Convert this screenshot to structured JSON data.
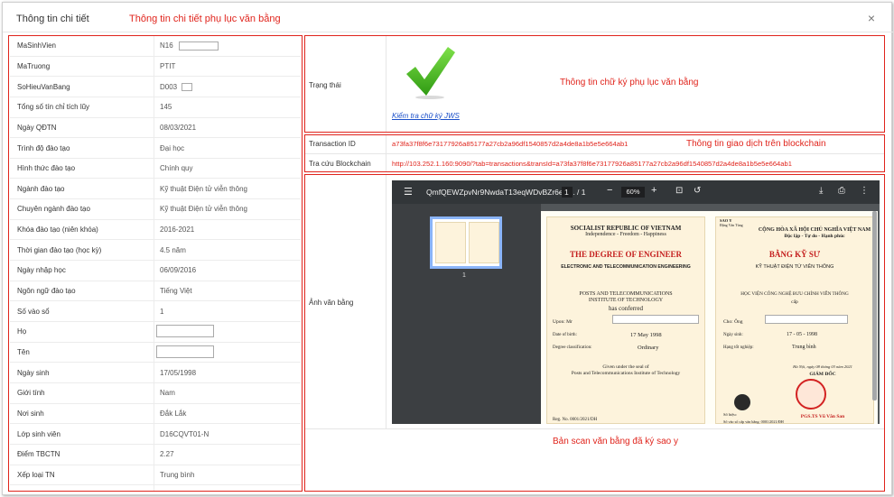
{
  "header": {
    "title": "Thông tin chi tiết",
    "annotation": "Thông tin chi tiết phụ lục văn bằng",
    "close_icon": "×"
  },
  "details": [
    {
      "label": "MaSinhVien",
      "value": "N16"
    },
    {
      "label": "MaTruong",
      "value": "PTIT"
    },
    {
      "label": "SoHieuVanBang",
      "value": "D003"
    },
    {
      "label": "Tổng số tín chỉ tích lũy",
      "value": "145"
    },
    {
      "label": "Ngày QĐTN",
      "value": "08/03/2021"
    },
    {
      "label": "Trình độ đào tạo",
      "value": "Đại học"
    },
    {
      "label": "Hình thức đào tạo",
      "value": "Chính quy"
    },
    {
      "label": "Ngành đào tạo",
      "value": "Kỹ thuật Điện tử viễn thông"
    },
    {
      "label": "Chuyên ngành đào tạo",
      "value": "Kỹ thuật Điện tử viễn thông"
    },
    {
      "label": "Khóa đào tạo (niên khóa)",
      "value": "2016-2021"
    },
    {
      "label": "Thời gian đào tạo (học kỳ)",
      "value": "4.5 năm"
    },
    {
      "label": "Ngày nhập học",
      "value": "06/09/2016"
    },
    {
      "label": "Ngôn ngữ đào tạo",
      "value": "Tiếng Việt"
    },
    {
      "label": "Số vào sổ",
      "value": "1"
    },
    {
      "label": "Họ",
      "value": ""
    },
    {
      "label": "Tên",
      "value": ""
    },
    {
      "label": "Ngày sinh",
      "value": "17/05/1998"
    },
    {
      "label": "Giới tính",
      "value": "Nam"
    },
    {
      "label": "Nơi sinh",
      "value": "Đắk Lắk"
    },
    {
      "label": "Lớp sinh viên",
      "value": "D16CQVT01-N"
    },
    {
      "label": "Điểm TBCTN",
      "value": "2.27"
    },
    {
      "label": "Xếp loại TN",
      "value": "Trung bình"
    }
  ],
  "signature": {
    "label": "Trạng thái",
    "annotation": "Thông tin chữ ký phụ lục văn bằng",
    "link": "Kiểm tra chữ ký JWS"
  },
  "transaction": {
    "id_label": "Transaction ID",
    "id_value": "a73fa37f8f6e73177926a85177a27cb2a96df1540857d2a4de8a1b5e5e664ab1",
    "blockchain_label": "Tra cứu Blockchain",
    "blockchain_value": "http://103.252.1.160:9090/?tab=transactions&transId=a73fa37f8f6e73177926a85177a27cb2a96df1540857d2a4de8a1b5e5e664ab1",
    "annotation": "Thông tin giao dịch trên blockchain"
  },
  "scan": {
    "label": "Ảnh văn bằng",
    "annotation": "Bản scan văn bằng đã ký sao y",
    "pdf": {
      "filename": "QmfQEWZpvNr9NwdaT13eqWDvBZr6eR...",
      "page_current": "1",
      "page_total": "/ 1",
      "zoom": "60%",
      "thumb_num": "1"
    },
    "doc_en": {
      "line1": "SOCIALIST REPUBLIC OF VIETNAM",
      "line2": "Independence - Freedom - Happiness",
      "degree": "THE DEGREE OF ENGINEER",
      "field": "ELECTRONIC AND TELECOMMUNICATION ENGINEERING",
      "inst1": "POSTS AND TELECOMMUNICATIONS",
      "inst2": "INSTITUTE OF TECHNOLOGY",
      "conferred": "has conferred",
      "upon": "Upon:    Mr",
      "dob_label": "Date of birth:",
      "dob": "17 May 1998",
      "class_label": "Degree classification:",
      "class": "Ordinary",
      "given1": "Given under the seal of",
      "given2": "Posts and Telecommunications Institute of Technology",
      "reg": "Reg. No.   0001/2021/DH"
    },
    "doc_vn": {
      "line1": "CỘNG HÒA XÃ HỘI CHỦ NGHĨA VIỆT NAM",
      "line2": "Độc lập - Tự do - Hạnh phúc",
      "degree": "BẰNG KỸ SƯ",
      "field": "KỸ THUẬT ĐIỆN TỬ VIỄN THÔNG",
      "inst": "HỌC VIỆN CÔNG NGHỆ BƯU CHÍNH VIỄN THÔNG",
      "cap": "cấp",
      "cho": "Cho:   Ông",
      "dob_label": "Ngày sinh:",
      "dob": "17 - 05 - 1998",
      "rank_label": "Hạng tốt nghiệp:",
      "rank": "Trung bình",
      "place": "Hà Nội, ngày  08  tháng  03  năm 2021",
      "director": "GIÁM ĐỐC",
      "signer": "PGS.TS Vũ Văn San",
      "sohieu": "Số hiệu:",
      "sovao": "Số vào sổ cấp văn bằng:   0001/2021/ĐH",
      "sao": "SAO Y",
      "sao_name": "Đặng Văn Tùng"
    }
  }
}
